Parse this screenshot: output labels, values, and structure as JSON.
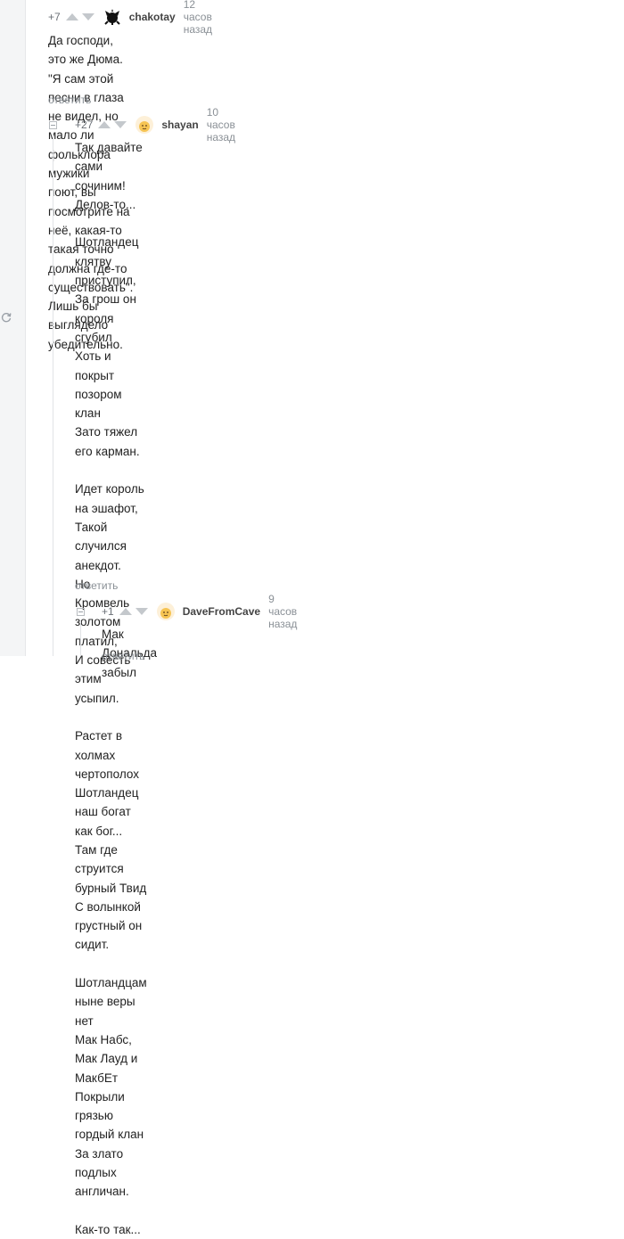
{
  "comments": [
    {
      "rating": "+7",
      "user": "chakotay",
      "time": "12 часов назад",
      "text": "Да господи, это же Дюма. \"Я сам этой песни в глаза не видел, но мало ли фольклора мужики\nпоют, вы посмотрите на неё, какая-то такая точно должна где-то существовать\". Лишь бы\nвыглядело убедительно.",
      "reply": "ответить"
    },
    {
      "rating": "+27",
      "user": "shayan",
      "time": "10 часов назад",
      "text": "Так давайте сами сочиним! Делов-то...\n\nШотландец клятву приступил,\nЗа грош он короля сгубил\nХоть и покрыт позором клан\nЗато тяжел его карман.\n\nИдет король на эшафот,\nТакой случился анекдот.\nНо Кромвель золотом платил,\nИ совесть этим усыпил.\n\nРастет в холмах чертополох\nШотландец наш богат как бог...\nТам где струится бурный Твид\nС волынкой грустный он сидит.\n\nШотландцам ныне веры нет\nМак Набс, Мак Лауд и МакбЕт\nПокрыли грязью гордый клан\nЗа злато подлых англичан.\n\nКак-то так...",
      "reply": "ответить"
    },
    {
      "rating": "+1",
      "user": "DaveFromCave",
      "time": "9 часов назад",
      "text": "Мак Дональда забыл",
      "reply": "ответить"
    }
  ],
  "icons": {
    "refresh": "refresh-icon",
    "collapse": "collapse-icon"
  },
  "colors": {
    "gutter": "#f4f5f6",
    "vote": "#c4c8cc",
    "muted": "#8a9096"
  }
}
